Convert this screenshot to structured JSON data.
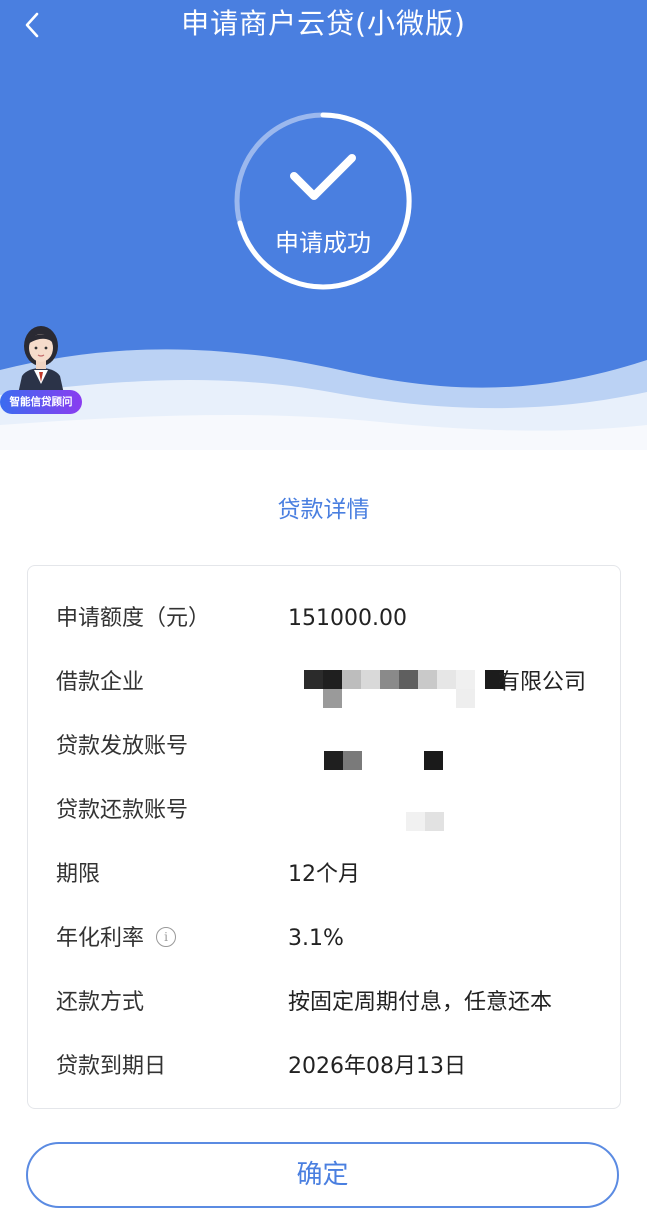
{
  "header": {
    "title": "申请商户云贷(小微版)",
    "back_icon": "chevron-left-icon"
  },
  "status": {
    "text": "申请成功",
    "icon": "checkmark-icon"
  },
  "advisor": {
    "badge": "智能信贷顾问"
  },
  "section": {
    "title": "贷款详情"
  },
  "details": [
    {
      "label": "申请额度（元）",
      "value": "151000.00"
    },
    {
      "label": "借款企业",
      "value": "有限公司"
    },
    {
      "label": "贷款发放账号",
      "value": ""
    },
    {
      "label": "贷款还款账号",
      "value": ""
    },
    {
      "label": "期限",
      "value": "12个月"
    },
    {
      "label": "年化利率",
      "value": "3.1%"
    },
    {
      "label": "还款方式",
      "value": "按固定周期付息，任意还本"
    },
    {
      "label": "贷款到期日",
      "value": "2026年08月13日"
    }
  ],
  "footer": {
    "confirm_label": "确定"
  },
  "colors": {
    "primary": "#4a7fe0",
    "badge_start": "#3a6cf0",
    "badge_end": "#8a3cf0"
  }
}
